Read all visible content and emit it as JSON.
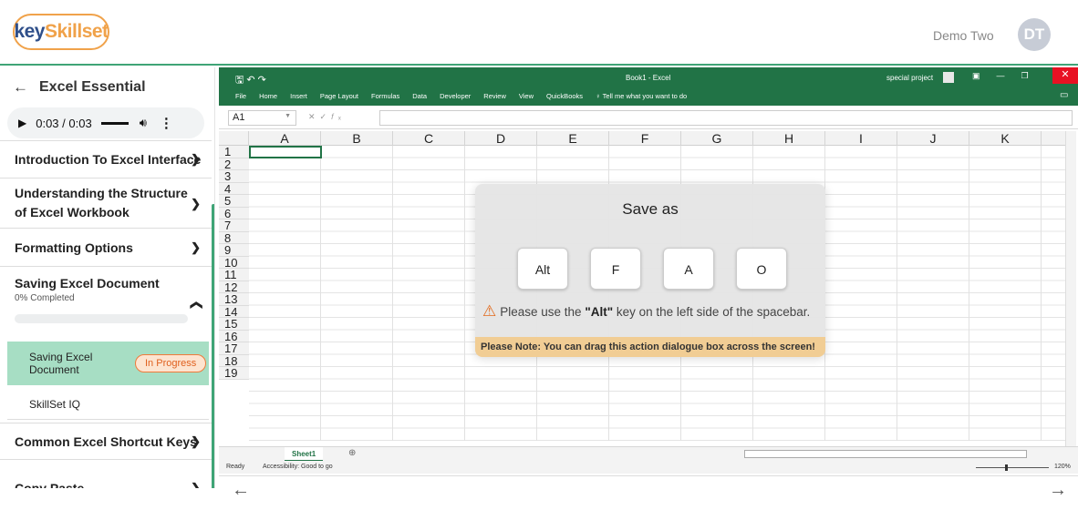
{
  "header": {
    "logo_part1": "key",
    "logo_part2": "Skillset",
    "user_name": "Demo Two",
    "avatar_initials": "DT"
  },
  "sidebar": {
    "back_label": "←",
    "course_title": "Excel Essential",
    "audio": {
      "time": "0:03 / 0:03"
    },
    "sections": [
      {
        "label": "Introduction To Excel Interface"
      },
      {
        "label": "Understanding the Structure of Excel Workbook"
      },
      {
        "label": "Formatting Options"
      },
      {
        "label": "Saving Excel Document",
        "progress_text": "0% Completed",
        "progress_value": 0
      },
      {
        "label": "Common Excel Shortcut Keys"
      },
      {
        "label": "Copy Paste"
      }
    ],
    "lessons": [
      {
        "label": "Saving Excel Document",
        "badge": "In Progress"
      },
      {
        "label": "SkillSet IQ"
      }
    ]
  },
  "excel": {
    "window_title": "Book1 - Excel",
    "account": "special project",
    "tabs": [
      "File",
      "Home",
      "Insert",
      "Page Layout",
      "Formulas",
      "Data",
      "Developer",
      "Review",
      "View",
      "QuickBooks",
      "♀ Tell me what you want to do"
    ],
    "name_box": "A1",
    "columns": [
      "A",
      "B",
      "C",
      "D",
      "E",
      "F",
      "G",
      "H",
      "I",
      "J",
      "K"
    ],
    "rows": [
      "1",
      "2",
      "3",
      "4",
      "5",
      "6",
      "7",
      "8",
      "9",
      "10",
      "11",
      "12",
      "13",
      "14",
      "15",
      "16",
      "17",
      "18",
      "19"
    ],
    "sheet_tab": "Sheet1",
    "status_ready": "Ready",
    "status_accessibility": "Accessibility: Good to go",
    "zoom": "120%"
  },
  "dialog": {
    "title": "Save as",
    "keys": [
      "Alt",
      "F",
      "A",
      "O"
    ],
    "hint_prefix": "Please use the ",
    "hint_key": "\"Alt\"",
    "hint_suffix": " key on the left side of the spacebar.",
    "note": "Please Note: You can drag this action dialogue box across the screen!"
  },
  "nav": {
    "prev": "←",
    "next": "→"
  },
  "colors": {
    "accent": "#3fa476",
    "excel_green": "#217346",
    "progress_badge": "#f07a3a"
  }
}
